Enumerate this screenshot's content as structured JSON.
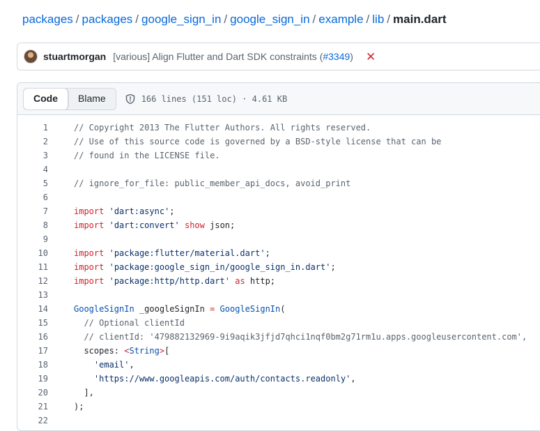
{
  "breadcrumb": {
    "items": [
      "packages",
      "packages",
      "google_sign_in",
      "google_sign_in",
      "example",
      "lib"
    ],
    "separator": "/",
    "current": "main.dart"
  },
  "commit": {
    "author": "stuartmorgan",
    "message_prefix": "[various] Align Flutter and Dart SDK constraints (",
    "pr_link": "#3349",
    "message_suffix": ")",
    "status_icon": "x-icon",
    "status_color": "#d1242f"
  },
  "toolbar": {
    "code_tab": "Code",
    "blame_tab": "Blame",
    "file_info": "166 lines (151 loc) · 4.61 KB"
  },
  "code": {
    "lines": [
      [
        [
          "c",
          "// Copyright 2013 The Flutter Authors. All rights reserved."
        ]
      ],
      [
        [
          "c",
          "// Use of this source code is governed by a BSD-style license that can be"
        ]
      ],
      [
        [
          "c",
          "// found in the LICENSE file."
        ]
      ],
      [],
      [
        [
          "c",
          "// ignore_for_file: public_member_api_docs, avoid_print"
        ]
      ],
      [],
      [
        [
          "k",
          "import"
        ],
        [
          "p",
          " "
        ],
        [
          "s",
          "'dart:async'"
        ],
        [
          "p",
          ";"
        ]
      ],
      [
        [
          "k",
          "import"
        ],
        [
          "p",
          " "
        ],
        [
          "s",
          "'dart:convert'"
        ],
        [
          "p",
          " "
        ],
        [
          "k",
          "show"
        ],
        [
          "p",
          " json;"
        ]
      ],
      [],
      [
        [
          "k",
          "import"
        ],
        [
          "p",
          " "
        ],
        [
          "s",
          "'package:flutter/material.dart'"
        ],
        [
          "p",
          ";"
        ]
      ],
      [
        [
          "k",
          "import"
        ],
        [
          "p",
          " "
        ],
        [
          "s",
          "'package:google_sign_in/google_sign_in.dart'"
        ],
        [
          "p",
          ";"
        ]
      ],
      [
        [
          "k",
          "import"
        ],
        [
          "p",
          " "
        ],
        [
          "s",
          "'package:http/http.dart'"
        ],
        [
          "p",
          " "
        ],
        [
          "k",
          "as"
        ],
        [
          "p",
          " http;"
        ]
      ],
      [],
      [
        [
          "t",
          "GoogleSignIn"
        ],
        [
          "p",
          " _googleSignIn "
        ],
        [
          "k",
          "="
        ],
        [
          "p",
          " "
        ],
        [
          "t",
          "GoogleSignIn"
        ],
        [
          "p",
          "("
        ]
      ],
      [
        [
          "c",
          "  // Optional clientId"
        ]
      ],
      [
        [
          "c",
          "  // clientId: '479882132969-9i9aqik3jfjd7qhci1nqf0bm2g71rm1u.apps.googleusercontent.com',"
        ]
      ],
      [
        [
          "p",
          "  scopes: "
        ],
        [
          "k",
          "<"
        ],
        [
          "t",
          "String"
        ],
        [
          "k",
          ">"
        ],
        [
          "p",
          "["
        ]
      ],
      [
        [
          "p",
          "    "
        ],
        [
          "s",
          "'email'"
        ],
        [
          "p",
          ","
        ]
      ],
      [
        [
          "p",
          "    "
        ],
        [
          "s",
          "'https://www.googleapis.com/auth/contacts.readonly'"
        ],
        [
          "p",
          ","
        ]
      ],
      [
        [
          "p",
          "  ],"
        ]
      ],
      [
        [
          "p",
          ");"
        ]
      ],
      []
    ]
  }
}
